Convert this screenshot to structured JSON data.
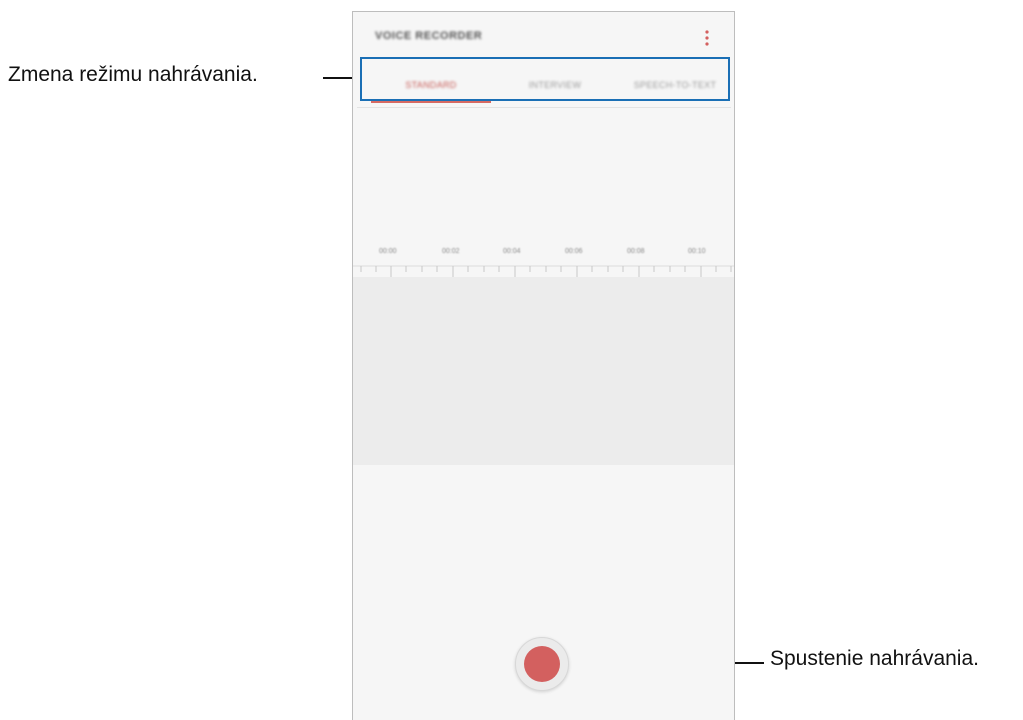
{
  "app": {
    "title": "VOICE RECORDER",
    "more_icon": "more-vert-icon"
  },
  "tabs": [
    {
      "label": "STANDARD",
      "active": true
    },
    {
      "label": "INTERVIEW",
      "active": false
    },
    {
      "label": "SPEECH-TO-TEXT",
      "active": false
    }
  ],
  "timeline": {
    "labels": [
      "00:00",
      "00:02",
      "00:04",
      "00:06",
      "00:08",
      "00:10"
    ]
  },
  "record_button": {
    "icon": "record-icon"
  },
  "callouts": {
    "mode": "Zmena režimu nahrávania.",
    "record": "Spustenie nahrávania."
  },
  "colors": {
    "accent": "#d3605f",
    "highlight_border": "#1a6fb5"
  }
}
